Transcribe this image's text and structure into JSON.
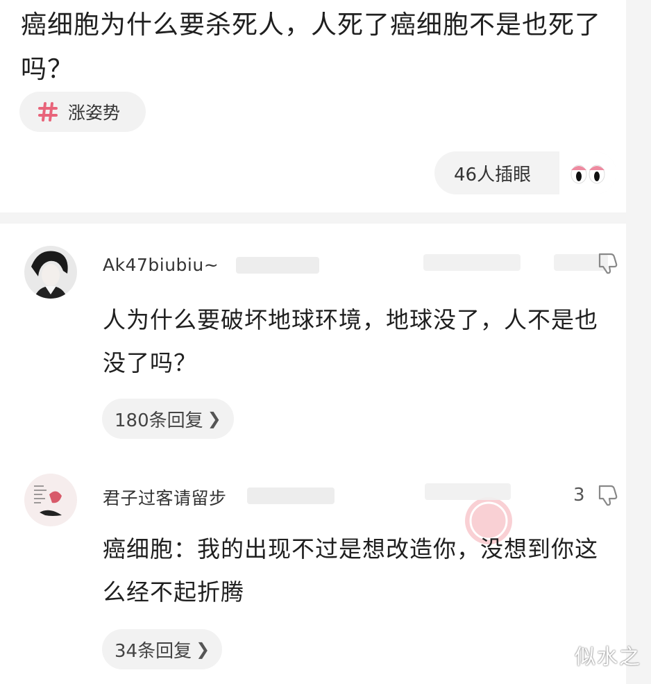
{
  "post": {
    "title": "癌细胞为什么要杀死人，人死了癌细胞不是也死了吗？",
    "topic": "涨姿势",
    "reaction": "46人插眼"
  },
  "comments": [
    {
      "username": "Ak47biubiu~",
      "text": "人为什么要破坏地球环境，地球没了，人不是也没了吗？",
      "replies": "180条回复"
    },
    {
      "username": "君子过客请留步",
      "likes": "3",
      "text": "癌细胞：我的出现不过是想改造你，没想到你这么经不起折腾",
      "replies": "34条回复"
    }
  ],
  "watermark": "似水之",
  "icons": {
    "topic": "hashtag-icon",
    "reaction": "eyes-icon",
    "reply_more": "chevron-right-icon",
    "dislike": "thumbs-down-icon"
  },
  "colors": {
    "hashtag": "#e8647a",
    "eyes_lid": "#ee8aa0"
  }
}
